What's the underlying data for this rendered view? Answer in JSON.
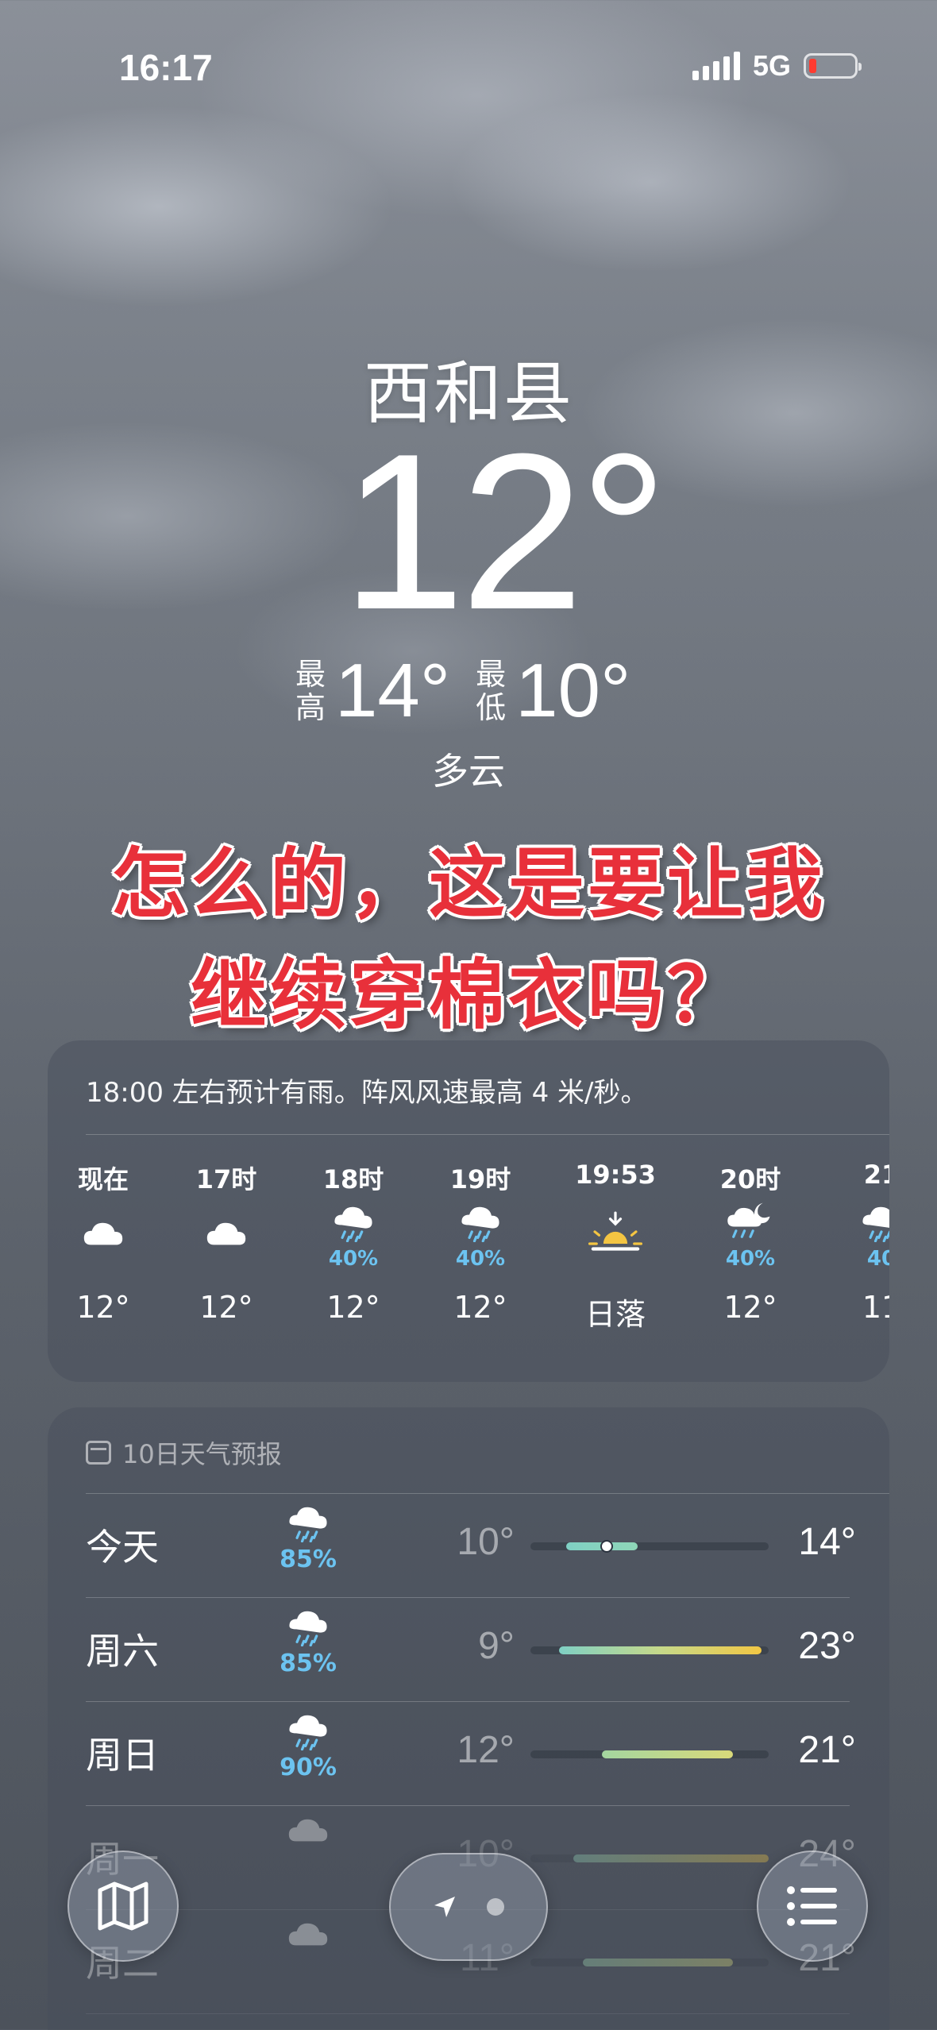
{
  "status_bar": {
    "time": "16:17",
    "network": "5G",
    "battery_level": 0.1,
    "battery_color": "#ff3b30"
  },
  "hero": {
    "city": "西和县",
    "temperature": "12°",
    "high_label": "最高",
    "high": "14°",
    "low_label": "最低",
    "low": "10°",
    "condition": "多云"
  },
  "overlay_caption": {
    "line1": "怎么的，这是要让我",
    "line2": "继续穿棉衣吗？",
    "color": "#e8303a"
  },
  "hourly": {
    "summary": "18:00 左右预计有雨。阵风风速最高 4 米/秒。",
    "items": [
      {
        "time": "现在",
        "icon": "cloud-icon",
        "pct": "",
        "value": "12°"
      },
      {
        "time": "17时",
        "icon": "cloud-icon",
        "pct": "",
        "value": "12°"
      },
      {
        "time": "18时",
        "icon": "rain-cloud-icon",
        "pct": "40%",
        "value": "12°"
      },
      {
        "time": "19时",
        "icon": "rain-cloud-icon",
        "pct": "40%",
        "value": "12°"
      },
      {
        "time": "19:53",
        "icon": "sunset-icon",
        "pct": "",
        "value": "日落"
      },
      {
        "time": "20时",
        "icon": "rain-moon-cloud-icon",
        "pct": "40%",
        "value": "12°"
      },
      {
        "time": "21",
        "icon": "rain-cloud-icon",
        "pct": "40",
        "value": "11"
      }
    ]
  },
  "daily": {
    "header": "10日天气预报",
    "rows": [
      {
        "day": "今天",
        "icon": "rain-cloud-icon",
        "pct": "85%",
        "low": "10°",
        "high": "14°",
        "range_start": 0.15,
        "range_end": 0.45,
        "current": 0.32,
        "gradient": "linear-gradient(90deg,#7fd0c4,#8fd6b8)"
      },
      {
        "day": "周六",
        "icon": "rain-cloud-icon",
        "pct": "85%",
        "low": "9°",
        "high": "23°",
        "range_start": 0.12,
        "range_end": 0.97,
        "gradient": "linear-gradient(90deg,#7fd0c4,#c6d98a,#f2c744)"
      },
      {
        "day": "周日",
        "icon": "rain-cloud-icon",
        "pct": "90%",
        "low": "12°",
        "high": "21°",
        "range_start": 0.3,
        "range_end": 0.85,
        "gradient": "linear-gradient(90deg,#a4d6a0,#d9d97a)"
      },
      {
        "day": "周一",
        "icon": "cloud-icon",
        "pct": "",
        "low": "10°",
        "high": "24°",
        "range_start": 0.18,
        "range_end": 1.0,
        "gradient": "linear-gradient(90deg,#8fd2b8,#f2c744)"
      },
      {
        "day": "周二",
        "icon": "cloud-icon",
        "pct": "",
        "low": "11°",
        "high": "21°",
        "range_start": 0.22,
        "range_end": 0.85,
        "gradient": "linear-gradient(90deg,#9ad4b0,#d9d97a)"
      }
    ]
  },
  "toolbar": {
    "map_icon": "map-icon",
    "location_icon": "location-arrow-icon",
    "list_icon": "list-icon"
  }
}
